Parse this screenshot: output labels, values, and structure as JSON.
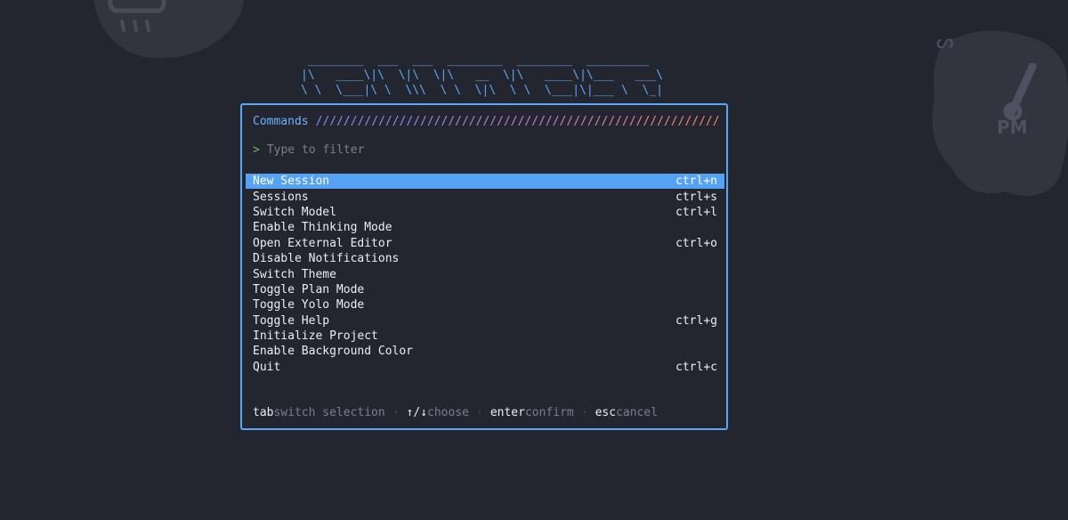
{
  "logo": {
    "ascii_line_1": " ________  ___  ___  ________  ________  _________",
    "ascii_line_2": "|\\   ____\\|\\  \\|\\  \\|\\   __  \\|\\   ____\\|\\___   ___\\",
    "ascii_line_3": "\\ \\  \\___|\\ \\  \\\\\\  \\ \\  \\|\\  \\ \\  \\___|\\|___ \\  \\_|"
  },
  "dialog": {
    "title": "Commands",
    "slashes": "//////////////////////////////////////////////////////////",
    "filter": {
      "prompt": ">",
      "placeholder": "Type to filter",
      "value": ""
    },
    "commands": [
      {
        "label": "New Session",
        "shortcut": "ctrl+n",
        "selected": true
      },
      {
        "label": "Sessions",
        "shortcut": "ctrl+s"
      },
      {
        "label": "Switch Model",
        "shortcut": "ctrl+l"
      },
      {
        "label": "Enable Thinking Mode",
        "shortcut": ""
      },
      {
        "label": "Open External Editor",
        "shortcut": "ctrl+o"
      },
      {
        "label": "Disable Notifications",
        "shortcut": ""
      },
      {
        "label": "Switch Theme",
        "shortcut": ""
      },
      {
        "label": "Toggle Plan Mode",
        "shortcut": ""
      },
      {
        "label": "Toggle Yolo Mode",
        "shortcut": ""
      },
      {
        "label": "Toggle Help",
        "shortcut": "ctrl+g"
      },
      {
        "label": "Initialize Project",
        "shortcut": ""
      },
      {
        "label": "Enable Background Color",
        "shortcut": ""
      },
      {
        "label": "Quit",
        "shortcut": "ctrl+c"
      }
    ],
    "footer": [
      {
        "key": "tab",
        "hint": "switch selection"
      },
      {
        "key": "↑/↓",
        "hint": "choose"
      },
      {
        "key": "enter",
        "hint": "confirm"
      },
      {
        "key": "esc",
        "hint": "cancel"
      }
    ],
    "footer_separator": "·"
  },
  "background": {
    "right_badge_text": "PM",
    "left_icon": "cloud-rain-icon",
    "right_icon": "thermometer-icon"
  },
  "colors": {
    "accent": "#5aa7f5",
    "selection": "#56a3f5",
    "prompt": "#5fbf6f",
    "muted": "#7b7f8d",
    "background": "#23252f"
  }
}
